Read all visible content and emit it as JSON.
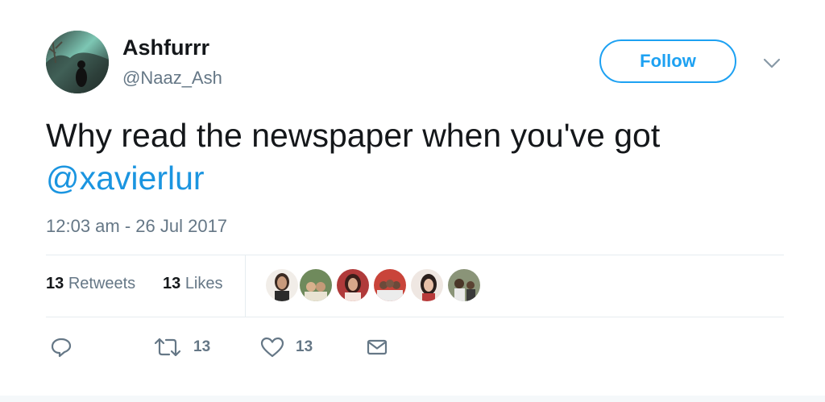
{
  "user": {
    "display_name": "Ashfurrr",
    "screen_name": "@Naaz_Ash",
    "avatar_icon": "profile-photo-lake-silhouette"
  },
  "follow_button": {
    "label": "Follow",
    "color": "#1da1f2"
  },
  "caret_icon": "chevron-down-icon",
  "tweet": {
    "text": "Why read the newspaper when you've got ",
    "mention": "@xavierlur",
    "mention_color": "#1b95e0",
    "timestamp": "12:03 am - 26 Jul 2017"
  },
  "stats": {
    "retweets_count": "13",
    "retweets_label": "Retweets",
    "likes_count": "13",
    "likes_label": "Likes"
  },
  "likers": [
    "liker-avatar",
    "liker-avatar",
    "liker-avatar",
    "liker-avatar",
    "liker-avatar",
    "liker-avatar",
    "liker-avatar"
  ],
  "actions": {
    "reply_icon": "reply-icon",
    "retweet_icon": "retweet-icon",
    "retweet_count": "13",
    "like_icon": "heart-icon",
    "like_count": "13",
    "dm_icon": "envelope-icon"
  }
}
